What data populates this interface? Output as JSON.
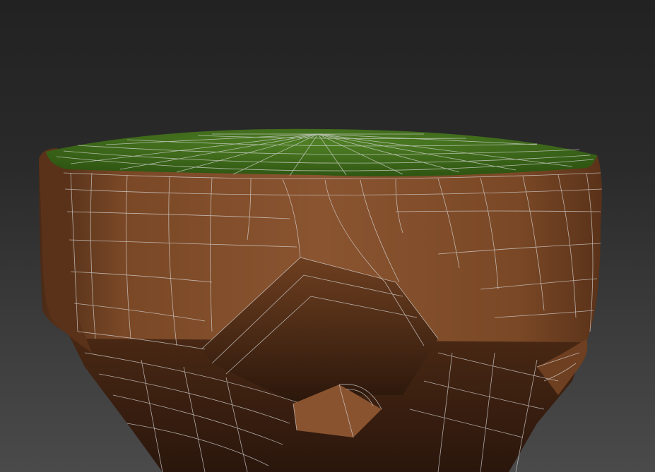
{
  "viewport": {
    "background_top": "#222222",
    "background_bottom": "#4a4a4a"
  },
  "model": {
    "top_color": "#3f6b1c",
    "side_color": "#7a4826",
    "shadow_color": "#2a160c",
    "wire_color": "#d8d8d8"
  }
}
